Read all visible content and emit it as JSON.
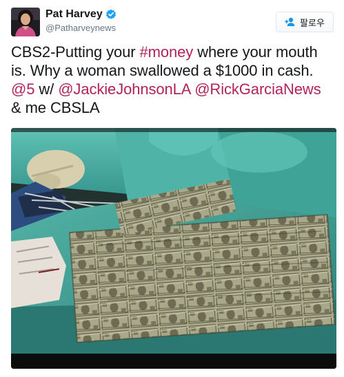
{
  "tweet": {
    "author": {
      "name": "Pat Harvey",
      "handle": "@Patharveynews",
      "verified": true,
      "avatar_icon": "profile-photo"
    },
    "follow_button": {
      "label": "팔로우",
      "icon": "add-user-icon"
    },
    "text_segments": [
      {
        "text": "CBS2-Putting  your ",
        "link": false
      },
      {
        "text": "#money",
        "link": true
      },
      {
        "text": " where your mouth is. Why a woman swallowed a $1000 in cash. ",
        "link": false
      },
      {
        "text": "@5",
        "link": true
      },
      {
        "text": " w/ ",
        "link": false
      },
      {
        "text": "@JackieJohnsonLA",
        "link": true
      },
      {
        "text": " ",
        "link": false
      },
      {
        "text": "@RickGarciaNews",
        "link": true
      },
      {
        "text": " & me CBSLA",
        "link": false
      }
    ],
    "media": {
      "type": "photo",
      "subject": "surgical-scene-wet-banknotes"
    }
  },
  "colors": {
    "link": "#b0235b",
    "verified": "#1da1f2",
    "text": "#14171a",
    "secondary": "#657786"
  }
}
